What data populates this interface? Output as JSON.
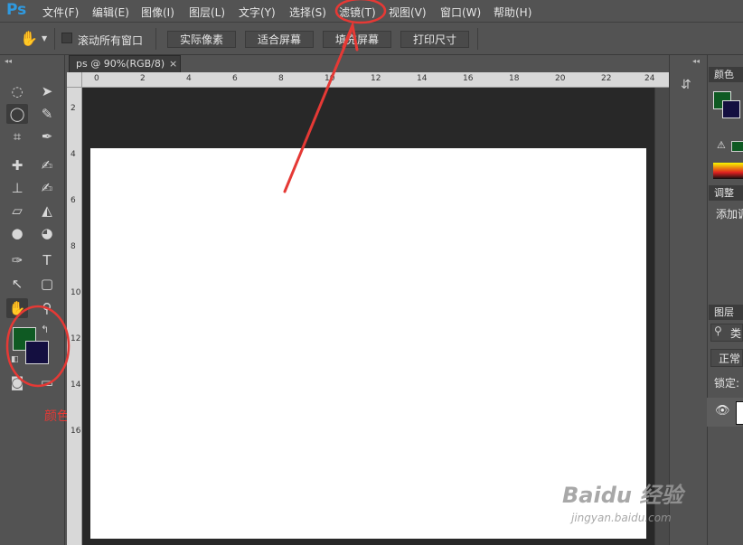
{
  "app": {
    "logo": "Ps"
  },
  "menu": [
    "文件(F)",
    "编辑(E)",
    "图像(I)",
    "图层(L)",
    "文字(Y)",
    "选择(S)",
    "滤镜(T)",
    "视图(V)",
    "窗口(W)",
    "帮助(H)"
  ],
  "options": {
    "scroll_all_windows": "滚动所有窗口",
    "buttons": [
      "实际像素",
      "适合屏幕",
      "填充屏幕",
      "打印尺寸"
    ]
  },
  "document": {
    "tab_title": "ps @ 90%(RGB/8)",
    "close_glyph": "×",
    "ruler_top": [
      "0",
      "2",
      "4",
      "6",
      "8",
      "10",
      "12",
      "14",
      "16",
      "18",
      "20",
      "22",
      "24"
    ],
    "ruler_left": [
      "2",
      "4",
      "6",
      "8",
      "10",
      "12",
      "14",
      "16"
    ]
  },
  "colors": {
    "foreground": "#0f5a23",
    "background": "#140f40",
    "annotation": "#e53935"
  },
  "annotation_label": "颜色",
  "panels": {
    "color_tab": "颜色",
    "adjust_tab": "调整",
    "adjust_text": "添加调",
    "layers_tab": "图层",
    "search_text": "类",
    "blend_mode": "正常",
    "lock_label": "锁定:"
  },
  "watermark": {
    "text": "Baidu 经验",
    "url": "jingyan.baidu.com"
  },
  "icons": [
    "hand-icon",
    "marquee-icon",
    "lasso-icon",
    "crop-icon",
    "brush-icon",
    "eyedropper-icon",
    "pen-icon",
    "text-icon",
    "zoom-icon",
    "eye-icon"
  ]
}
